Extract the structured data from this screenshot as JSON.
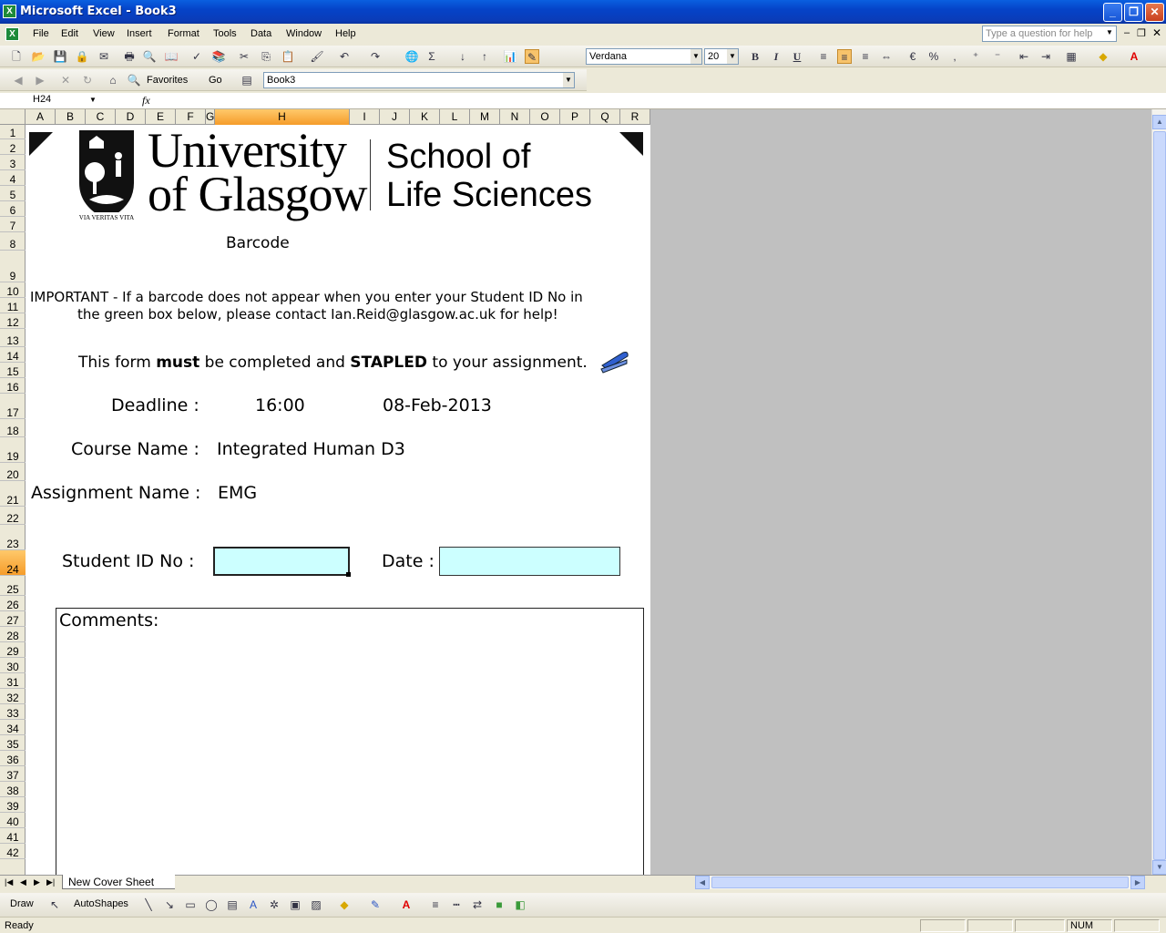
{
  "window": {
    "title": "Microsoft Excel - Book3",
    "app_icon": "excel-icon"
  },
  "menu": {
    "items": [
      "File",
      "Edit",
      "View",
      "Insert",
      "Format",
      "Tools",
      "Data",
      "Window",
      "Help"
    ],
    "help_placeholder": "Type a question for help"
  },
  "formatting": {
    "font": "Verdana",
    "size": "20",
    "bold": "B",
    "italic": "I",
    "underline": "U"
  },
  "web_toolbar": {
    "favorites": "Favorites",
    "go": "Go",
    "address": "Book3"
  },
  "formula_bar": {
    "name_box": "H24",
    "fx": "fx",
    "value": ""
  },
  "columns": [
    "A",
    "B",
    "C",
    "D",
    "E",
    "F",
    "G",
    "H",
    "I",
    "J",
    "K",
    "L",
    "M",
    "N",
    "O",
    "P",
    "Q",
    "R"
  ],
  "selected_column": "H",
  "rows": [
    "1",
    "2",
    "3",
    "4",
    "5",
    "6",
    "7",
    "8",
    "9",
    "10",
    "11",
    "12",
    "13",
    "14",
    "15",
    "16",
    "17",
    "18",
    "19",
    "20",
    "21",
    "22",
    "23",
    "24",
    "25",
    "26",
    "27",
    "28",
    "29",
    "30",
    "31",
    "32",
    "33",
    "34",
    "35",
    "36",
    "37",
    "38",
    "39",
    "40",
    "41",
    "42"
  ],
  "selected_row": "24",
  "sheet": {
    "logo_line1": "University",
    "logo_line2": "of Glasgow",
    "logo_motto": "VIA VERITAS VITA",
    "school_line1": "School of",
    "school_line2": "Life Sciences",
    "barcode_label": "Barcode",
    "important_line1": "IMPORTANT - If a barcode does not appear when you enter your Student ID No in",
    "important_line2": "the green box below, please contact Ian.Reid@glasgow.ac.uk for help!",
    "stapled_pre": "This form ",
    "stapled_must": "must",
    "stapled_mid": " be completed and ",
    "stapled_bold": "STAPLED",
    "stapled_post": " to your assignment.",
    "deadline_label": "Deadline :",
    "deadline_time": "16:00",
    "deadline_date": "08-Feb-2013",
    "course_label": "Course Name :",
    "course_value": "Integrated Human D3",
    "assignment_label": "Assignment Name :",
    "assignment_value": "EMG",
    "student_id_label": "Student ID No :",
    "date_label": "Date :",
    "comments_label": "Comments:"
  },
  "sheet_tab": "New Cover Sheet",
  "drawing": {
    "draw": "Draw",
    "autoshapes": "AutoShapes"
  },
  "status": {
    "left": "Ready",
    "num": "NUM"
  }
}
